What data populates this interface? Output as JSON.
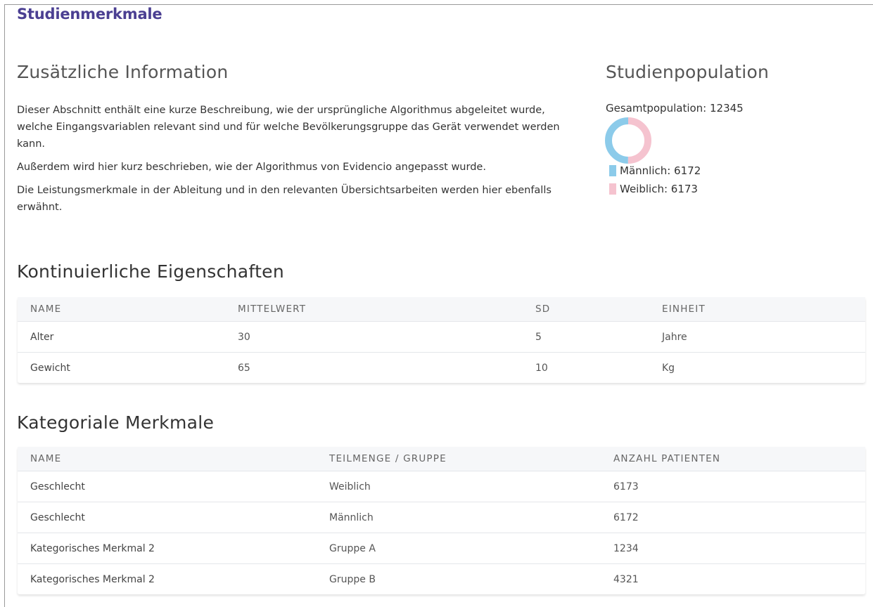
{
  "page_title": "Studienmerkmale",
  "info": {
    "heading": "Zusätzliche Information",
    "paragraphs": [
      "Dieser Abschnitt enthält eine kurze Beschreibung, wie der ursprüngliche Algorithmus abgeleitet wurde, welche Eingangsvariablen relevant sind und für welche Bevölkerungsgruppe das Gerät verwendet werden kann.",
      "Außerdem wird hier kurz beschrieben, wie der Algorithmus von Evidencio angepasst wurde.",
      "Die Leistungsmerkmale in der Ableitung und in den relevanten Übersichtsarbeiten werden hier ebenfalls erwähnt."
    ]
  },
  "population": {
    "heading": "Studienpopulation",
    "total_label": "Gesamtpopulation: 12345",
    "male": 6172,
    "female": 6173,
    "male_label": "Männlich: 6172",
    "female_label": "Weiblich: 6173",
    "male_color": "#8ccbea",
    "female_color": "#f5c3cf"
  },
  "continuous": {
    "heading": "Kontinuierliche Eigenschaften",
    "columns": [
      "NAME",
      "MITTELWERT",
      "SD",
      "EINHEIT"
    ],
    "rows": [
      [
        "Alter",
        "30",
        "5",
        "Jahre"
      ],
      [
        "Gewicht",
        "65",
        "10",
        "Kg"
      ]
    ]
  },
  "categorical": {
    "heading": "Kategoriale Merkmale",
    "columns": [
      "NAME",
      "TEILMENGE / GRUPPE",
      "ANZAHL PATIENTEN"
    ],
    "rows": [
      [
        "Geschlecht",
        "Weiblich",
        "6173"
      ],
      [
        "Geschlecht",
        "Männlich",
        "6172"
      ],
      [
        "Kategorisches Merkmal 2",
        "Gruppe A",
        "1234"
      ],
      [
        "Kategorisches Merkmal 2",
        "Gruppe B",
        "4321"
      ]
    ]
  }
}
